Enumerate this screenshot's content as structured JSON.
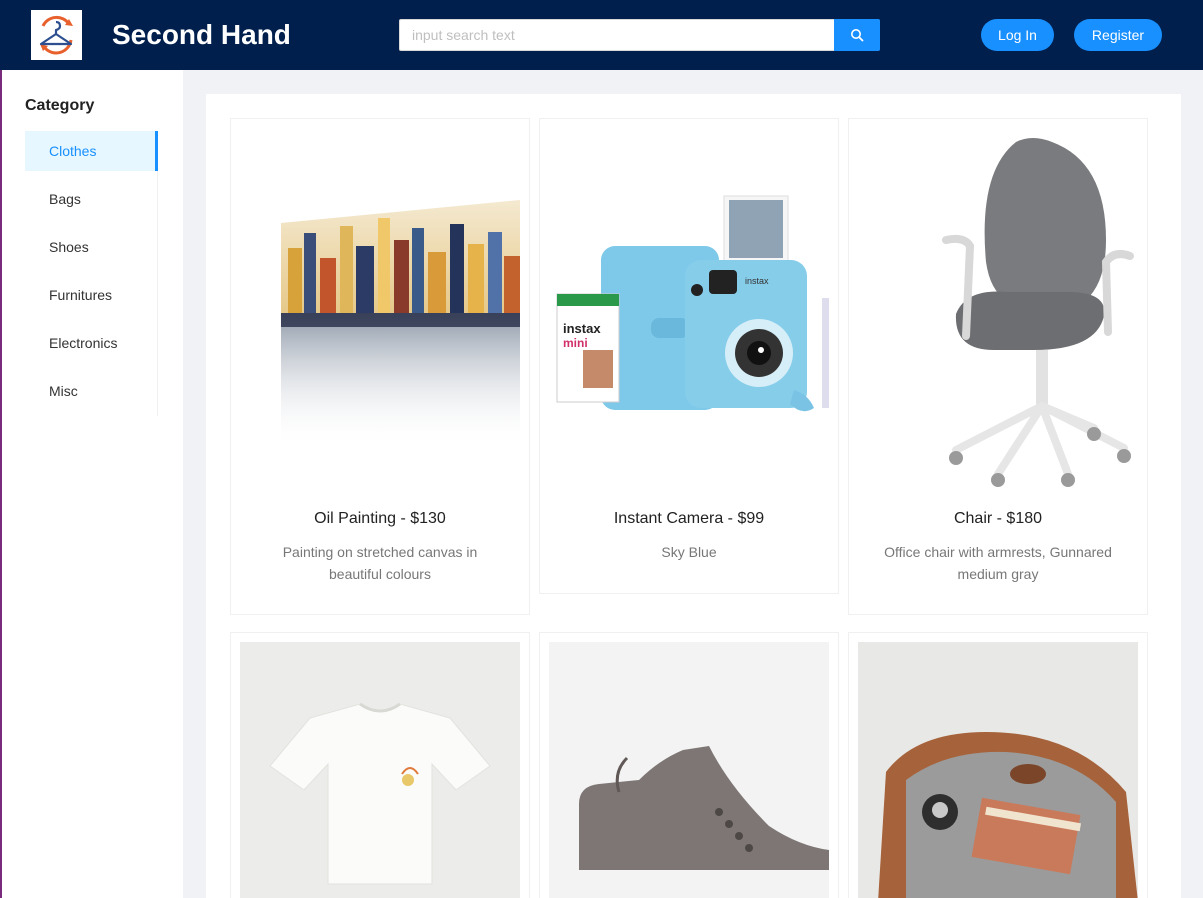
{
  "header": {
    "brand": "Second Hand",
    "logo_icon": "hanger-recycle-icon",
    "search_placeholder": "input search text",
    "search_value": "",
    "search_icon": "search-icon",
    "login_label": "Log In",
    "register_label": "Register",
    "colors": {
      "bar": "#001f4d",
      "accent": "#1890ff"
    }
  },
  "sidebar": {
    "title": "Category",
    "items": [
      {
        "label": "Clothes",
        "active": true
      },
      {
        "label": "Bags",
        "active": false
      },
      {
        "label": "Shoes",
        "active": false
      },
      {
        "label": "Furnitures",
        "active": false
      },
      {
        "label": "Electronics",
        "active": false
      },
      {
        "label": "Misc",
        "active": false
      }
    ]
  },
  "products": [
    {
      "title": "Oil Painting - $130",
      "description": "Painting on stretched canvas in beautiful colours",
      "image": "city-oil-painting"
    },
    {
      "title": "Instant Camera - $99",
      "description": "Sky Blue",
      "image": "instax-camera-bundle"
    },
    {
      "title": "Chair - $180",
      "description": "Office chair with armrests, Gunnared medium gray",
      "image": "office-chair"
    },
    {
      "title": "",
      "description": "",
      "image": "white-tshirt"
    },
    {
      "title": "",
      "description": "",
      "image": "gray-boot"
    },
    {
      "title": "",
      "description": "",
      "image": "leather-bag"
    }
  ]
}
